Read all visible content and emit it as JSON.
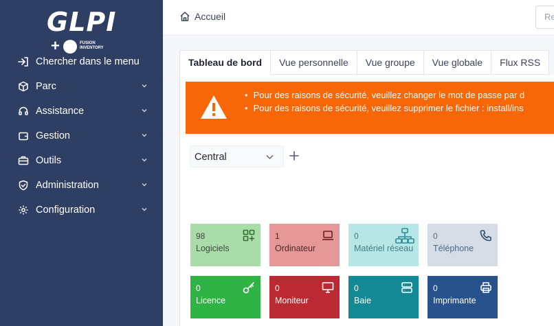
{
  "logo": {
    "text": "GLPI",
    "plus": "+",
    "plugin_line1": "FUSION",
    "plugin_line2": "INVENTORY"
  },
  "sidebar": {
    "search_label": "Chercher dans le menu",
    "items": [
      {
        "label": "Parc",
        "icon": "box-icon"
      },
      {
        "label": "Assistance",
        "icon": "headset-icon"
      },
      {
        "label": "Gestion",
        "icon": "wallet-icon"
      },
      {
        "label": "Outils",
        "icon": "briefcase-icon"
      },
      {
        "label": "Administration",
        "icon": "shield-icon"
      },
      {
        "label": "Configuration",
        "icon": "gear-icon"
      }
    ]
  },
  "topbar": {
    "breadcrumb": "Accueil",
    "search_placeholder": "Re"
  },
  "tabs": [
    {
      "label": "Tableau de bord",
      "active": true
    },
    {
      "label": "Vue personnelle"
    },
    {
      "label": "Vue groupe"
    },
    {
      "label": "Vue globale"
    },
    {
      "label": "Flux RSS"
    }
  ],
  "alert": {
    "messages": [
      "Pour des raisons de sécurité, veuillez changer le mot de passe par d",
      "Pour des raisons de sécurité, veuillez supprimer le fichier : install/ins"
    ]
  },
  "dashboard": {
    "selected": "Central"
  },
  "cards": [
    {
      "count": "98",
      "label": "Logiciels",
      "icon": "apps-add-icon",
      "bg": "#a9dca9",
      "fg": "#3b4a3b",
      "icolor": "#2f6e2f"
    },
    {
      "count": "1",
      "label": "Ordinateur",
      "icon": "laptop-icon",
      "bg": "#e59797",
      "fg": "#4a2a2a",
      "icolor": "#6a1f1f"
    },
    {
      "count": "0",
      "label": "Matériel réseau",
      "icon": "network-icon",
      "bg": "#b7e6e6",
      "fg": "#3f7e83",
      "icolor": "#2f8a94"
    },
    {
      "count": "0",
      "label": "Téléphone",
      "icon": "phone-icon",
      "bg": "#d6dce6",
      "fg": "#4b6a8a",
      "icolor": "#2d4a70"
    },
    {
      "count": "0",
      "label": "Licence",
      "icon": "key-icon",
      "bg": "#2fb344",
      "fg": "#ffffff",
      "icolor": "#ffffff"
    },
    {
      "count": "0",
      "label": "Moniteur",
      "icon": "monitor-icon",
      "bg": "#bb2a33",
      "fg": "#ffffff",
      "icolor": "#ffffff"
    },
    {
      "count": "0",
      "label": "Baie",
      "icon": "server-icon",
      "bg": "#138996",
      "fg": "#ffffff",
      "icolor": "#ffffff"
    },
    {
      "count": "0",
      "label": "Imprimante",
      "icon": "printer-icon",
      "bg": "#28528c",
      "fg": "#ffffff",
      "icolor": "#ffffff"
    }
  ]
}
